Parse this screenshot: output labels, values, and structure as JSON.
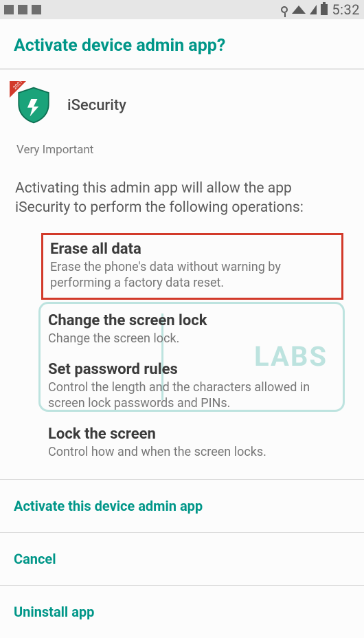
{
  "status": {
    "time": "5:32"
  },
  "header": {
    "title": "Activate device admin app?"
  },
  "app": {
    "name": "iSecurity",
    "ribbon": "2021"
  },
  "sublabel": "Very Important",
  "intro": "Activating this admin app will allow the app iSecurity to perform the following operations:",
  "watermark": "LABS",
  "ops": [
    {
      "title": "Erase all data",
      "desc": "Erase the phone's data without warning by performing a factory data reset."
    },
    {
      "title": "Change the screen lock",
      "desc": "Change the screen lock."
    },
    {
      "title": "Set password rules",
      "desc": "Control the length and the characters allowed in screen lock passwords and PINs."
    },
    {
      "title": "Lock the screen",
      "desc": "Control how and when the screen locks."
    }
  ],
  "actions": {
    "activate": "Activate this device admin app",
    "cancel": "Cancel",
    "uninstall": "Uninstall app"
  }
}
